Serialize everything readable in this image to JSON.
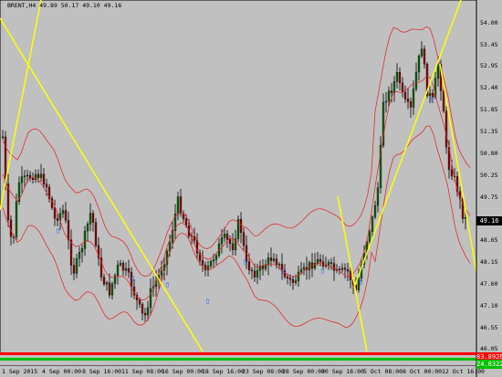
{
  "header": {
    "symbol": "BRENT,H4",
    "ohlc": "49.89 50.17 49.10 49.16"
  },
  "price_axis": {
    "labels": [
      "54.00",
      "53.45",
      "52.95",
      "52.40",
      "51.85",
      "51.35",
      "50.80",
      "50.25",
      "49.75",
      "49.20",
      "48.65",
      "48.15",
      "47.60",
      "47.10",
      "46.55",
      "46.05"
    ],
    "current_price": "49.16"
  },
  "indicator_panel": {
    "upper_value": "83.8926",
    "lower_value": "24.8322"
  },
  "time_axis": {
    "labels": [
      "1 Sep 2015",
      "4 Sep 00:00",
      "8 Sep 16:00",
      "11 Sep 08:00",
      "16 Sep 00:00",
      "18 Sep 16:00",
      "23 Sep 08:00",
      "28 Sep 00:00",
      "30 Sep 16:00",
      "5 Oct 08:00",
      "8 Oct 00:00",
      "12 Oct 16:00"
    ]
  },
  "colors": {
    "background": "#c0c0c0",
    "candle_bull": "#006400",
    "candle_bear": "#8b0000",
    "bollinger": "#e03030",
    "trendline": "#ffff00",
    "current_price_tag": "#000000",
    "indicator_upper": "#ff0000",
    "indicator_lower": "#00c000",
    "fractal_marker": "#2060ff"
  },
  "icons": {
    "fractal_markers": "arrow-up-icon",
    "fractal_count": 9
  }
}
